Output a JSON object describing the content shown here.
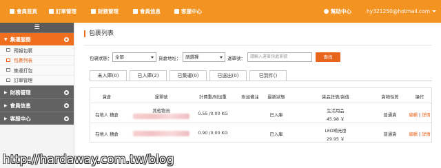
{
  "topnav": {
    "items": [
      {
        "label": "會員首頁",
        "icon": "home-icon"
      },
      {
        "label": "訂單管理",
        "icon": "cart-icon"
      },
      {
        "label": "財務管理",
        "icon": "money-icon"
      },
      {
        "label": "會員信息",
        "icon": "user-icon"
      },
      {
        "label": "客服中心",
        "icon": "support-icon"
      }
    ],
    "help": "幫助中心",
    "account": "hy321250@hotmail.com"
  },
  "sidebar": {
    "toggle": "☰",
    "sections": [
      {
        "label": "集運服務",
        "items": [
          "預報包裹",
          "包裹列表",
          "集運打包",
          "訂單管理"
        ]
      },
      {
        "label": "財務管理",
        "items": []
      },
      {
        "label": "會員信息",
        "items": []
      },
      {
        "label": "客服中心",
        "items": []
      }
    ]
  },
  "page": {
    "title": "包裹列表",
    "filter": {
      "status_label": "包裹狀態：",
      "status_value": "全部",
      "warehouse_label": "貨倉地址：",
      "warehouse_value": "請選擇",
      "tracking_label": "運單號：",
      "tracking_placeholder": "請輸入運單快遞單號",
      "search": "查找"
    },
    "tabs": [
      "未入庫(0)",
      "已入庫(2)",
      "已集運(0)",
      "已送出(0)",
      "已到件()"
    ],
    "table": {
      "headers": [
        "貨倉",
        "運單號",
        "計費重/附加重",
        "附加備注",
        "最新狀態",
        "貨品詳情/貨值",
        "貨物性質",
        "操作"
      ],
      "rows": [
        {
          "warehouse": "在地人 穗倉",
          "tracking": "其他物流",
          "weight": "0.55 /0.00 KG",
          "note": "",
          "status": "已入庫",
          "goods": "生活用品",
          "value": "45.98 ￥",
          "nature": "普通貨",
          "edit": "編輯",
          "detail": "詳情"
        },
        {
          "warehouse": "在地人 穗倉",
          "tracking": "",
          "weight": "0.90 /0.00 KG",
          "note": "",
          "status": "已入庫",
          "goods": "LED嗬光燈",
          "value": "29.95 ￥",
          "nature": "普通貨",
          "edit": "編輯",
          "detail": "詳情"
        }
      ]
    }
  },
  "watermark": "http://hardaway.com.tw/blog",
  "colors": {
    "accent": "#f39321",
    "active": "#f06f1f",
    "button": "#e8641b"
  }
}
